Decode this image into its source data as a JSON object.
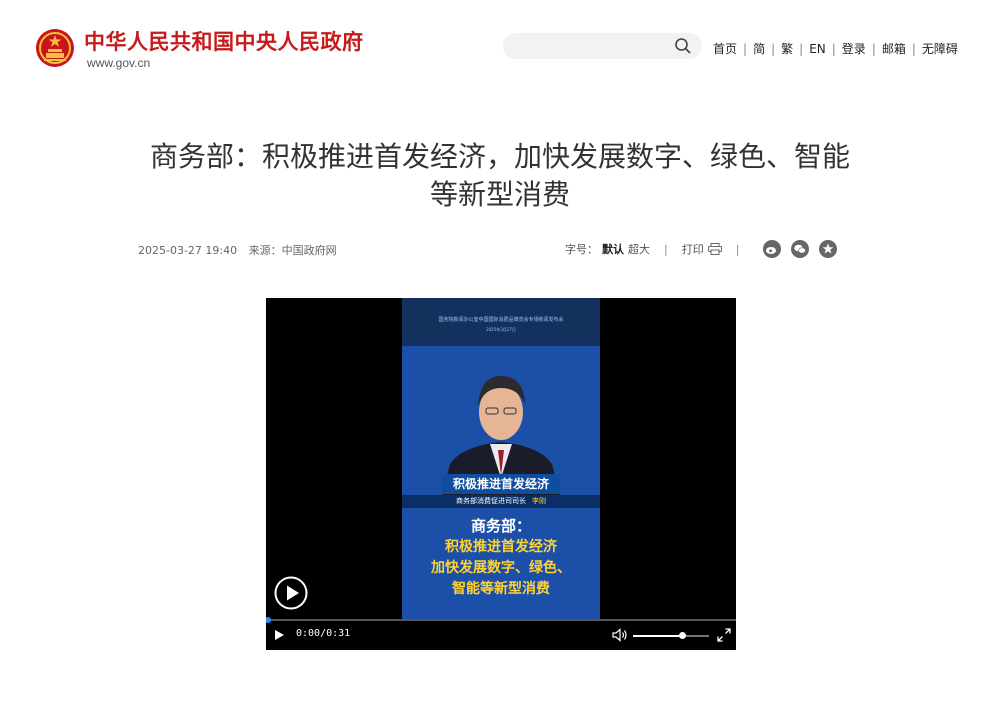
{
  "header": {
    "site_title": "中华人民共和国中央人民政府",
    "site_domain": "www.gov.cn",
    "search": {
      "placeholder": "",
      "value": ""
    },
    "nav": [
      "首页",
      "简",
      "繁",
      "EN",
      "登录",
      "邮箱",
      "无障碍"
    ]
  },
  "article": {
    "title_line1": "商务部：积极推进首发经济，加快发展数字、绿色、智能",
    "title_line2": "等新型消费",
    "date": "2025-03-27 19:40",
    "source_label": "来源：",
    "source": "中国政府网",
    "font_label": "字号：",
    "font_default": "默认",
    "font_large": "超大",
    "print_label": "打印",
    "share_icons": [
      "weibo-icon",
      "wechat-icon",
      "favorite-icon"
    ]
  },
  "video": {
    "banner_line1": "国务院新闻办公室中国国际消费品博览会专场新闻发布会",
    "banner_line2": "2025年3月27日",
    "caption_main": "积极推进首发经济",
    "caption_sub": "商务部消费促进司司长",
    "speaker": "李刚",
    "overlay_line1": "商务部：",
    "overlay_line2": "积极推进首发经济",
    "overlay_line3": "加快发展数字、绿色、",
    "overlay_line4": "智能等新型消费",
    "time_display": "0:00/0:31",
    "progress_percent": 1,
    "volume_percent": 64,
    "colors": {
      "accent": "#2a8cff",
      "frame_blue": "#1c50a8",
      "caption_yellow": "#ffd234",
      "brand_red": "#c51b1b"
    }
  }
}
